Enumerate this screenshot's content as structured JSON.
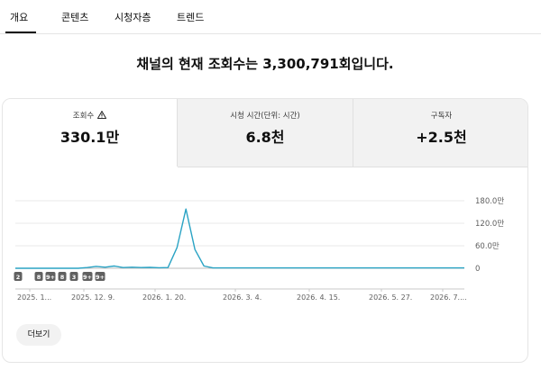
{
  "tabs": [
    {
      "label": "개요"
    },
    {
      "label": "콘텐츠"
    },
    {
      "label": "시청자층"
    },
    {
      "label": "트렌드"
    }
  ],
  "headline": "채널의 현재 조회수는 3,300,791회입니다.",
  "metrics": [
    {
      "label": "조회수",
      "value": "330.1만"
    },
    {
      "label": "시청 시간(단위: 시간)",
      "value": "6.8천"
    },
    {
      "label": "구독자",
      "value": "+2.5천"
    }
  ],
  "chart_data": {
    "type": "line",
    "y_tick_labels": [
      "180.0만",
      "120.0만",
      "60.0만",
      "0"
    ],
    "y_ticks": [
      1800000,
      1200000,
      600000,
      0
    ],
    "ylim": [
      0,
      1800000
    ],
    "x_tick_labels": [
      "2025. 1...",
      "2025. 12. 9.",
      "2026. 1. 20.",
      "2026. 3. 4.",
      "2026. 4. 15.",
      "2026. 5. 27.",
      "2026. 7...."
    ],
    "series": [
      {
        "x": [
          0,
          4,
          6,
          8,
          10,
          12,
          14,
          16,
          18,
          20,
          22,
          24,
          26,
          28,
          30,
          32,
          34,
          36,
          38,
          40,
          42,
          44,
          46,
          48,
          50,
          52,
          54,
          56,
          58,
          60,
          62,
          64,
          66,
          68,
          70,
          72,
          74,
          76,
          78,
          80,
          82,
          84,
          86,
          88,
          90,
          92,
          94,
          96,
          100
        ],
        "values": [
          0,
          0,
          0,
          0,
          0,
          0,
          0,
          20000,
          50000,
          30000,
          60000,
          20000,
          30000,
          20000,
          25000,
          15000,
          20000,
          550000,
          1580000,
          500000,
          60000,
          10000,
          10000,
          10000,
          10000,
          10000,
          10000,
          10000,
          10000,
          10000,
          10000,
          10000,
          10000,
          10000,
          10000,
          10000,
          10000,
          10000,
          10000,
          10000,
          10000,
          10000,
          10000,
          10000,
          10000,
          10000,
          10000,
          10000,
          10000
        ],
        "color": "#2aa3c4"
      }
    ],
    "markers": [
      "2",
      "8",
      "9+",
      "8",
      "3",
      "9+",
      "9+"
    ],
    "grid": true
  },
  "more_button": "더보기"
}
